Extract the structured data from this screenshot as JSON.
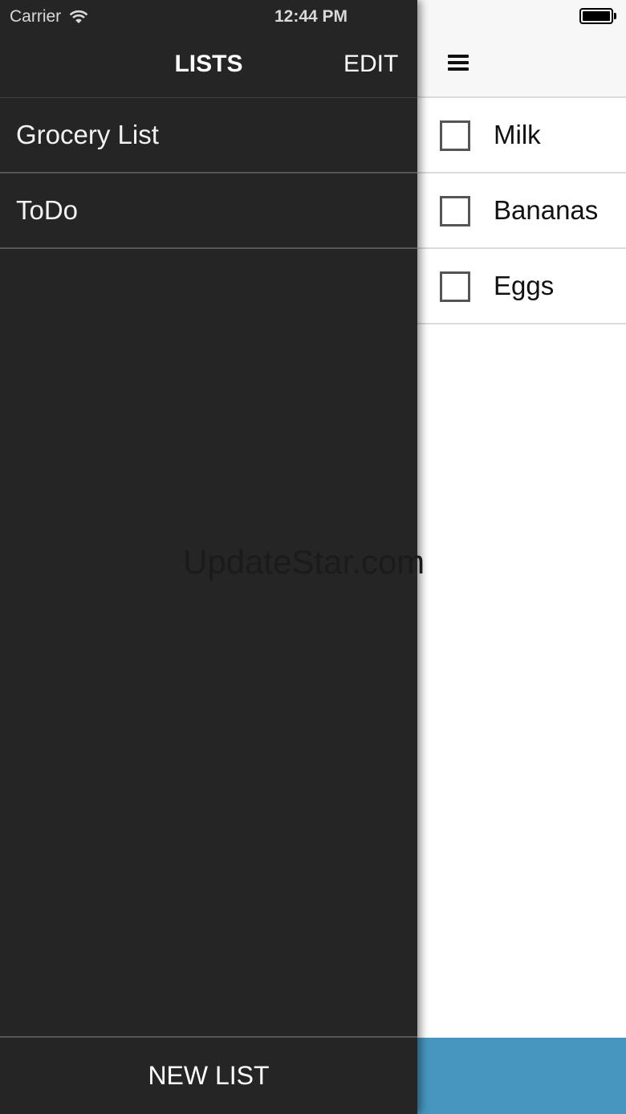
{
  "status_bar": {
    "carrier": "Carrier",
    "time": "12:44 PM",
    "wifi_icon": "wifi-icon",
    "battery_icon": "battery-icon"
  },
  "drawer": {
    "title": "LISTS",
    "edit_label": "EDIT",
    "lists": [
      {
        "label": "Grocery List"
      },
      {
        "label": "ToDo"
      }
    ],
    "new_list_label": "NEW LIST",
    "background": "#252525"
  },
  "main": {
    "menu_icon": "hamburger-menu-icon",
    "items": [
      {
        "label": "Milk",
        "checked": false
      },
      {
        "label": "Bananas",
        "checked": false
      },
      {
        "label": "Eggs",
        "checked": false
      }
    ],
    "bottom_bar_color": "#4796bf"
  },
  "watermark": "UpdateStar.com"
}
